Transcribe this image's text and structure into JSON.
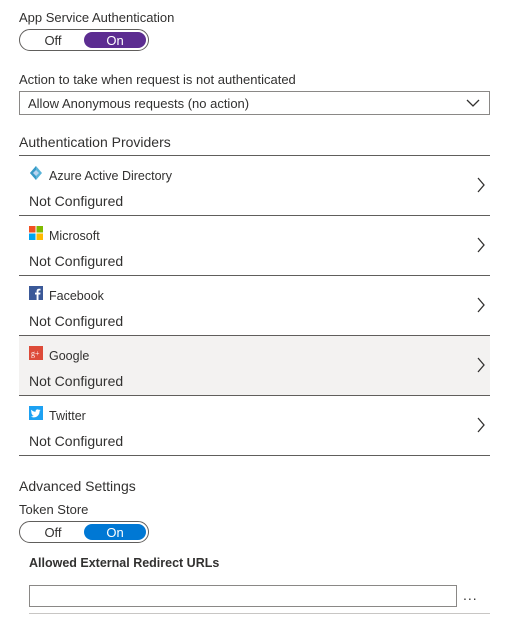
{
  "auth": {
    "label": "App Service Authentication",
    "toggle": {
      "off": "Off",
      "on": "On",
      "selected": "on",
      "color": "#5c2d91"
    }
  },
  "action": {
    "label": "Action to take when request is not authenticated",
    "selected": "Allow Anonymous requests (no action)"
  },
  "providers_section": {
    "title": "Authentication Providers",
    "items": [
      {
        "name": "Azure Active Directory",
        "status": "Not Configured",
        "icon": "azure-ad-icon"
      },
      {
        "name": "Microsoft",
        "status": "Not Configured",
        "icon": "microsoft-icon"
      },
      {
        "name": "Facebook",
        "status": "Not Configured",
        "icon": "facebook-icon"
      },
      {
        "name": "Google",
        "status": "Not Configured",
        "icon": "google-plus-icon"
      },
      {
        "name": "Twitter",
        "status": "Not Configured",
        "icon": "twitter-icon"
      }
    ]
  },
  "advanced": {
    "title": "Advanced Settings",
    "token_store": {
      "label": "Token Store",
      "toggle": {
        "off": "Off",
        "on": "On",
        "selected": "on",
        "color": "#0078d4"
      }
    },
    "redirect_urls": {
      "label": "Allowed External Redirect URLs",
      "value": "",
      "more": "..."
    }
  }
}
